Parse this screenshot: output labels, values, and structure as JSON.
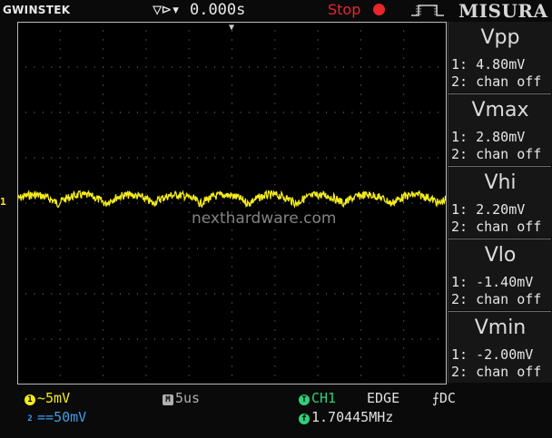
{
  "top": {
    "brand": "GWINSTEK",
    "trigger_position": "0.000s",
    "run_state": "Stop",
    "menu_title": "MISURA"
  },
  "screen": {
    "watermark": "nexthardware.com",
    "ch1_marker": "1"
  },
  "measurements": [
    {
      "name": "Vpp",
      "ch1": "1: 4.80mV",
      "ch2": "2: chan off"
    },
    {
      "name": "Vmax",
      "ch1": "1: 2.80mV",
      "ch2": "2: chan off"
    },
    {
      "name": "Vhi",
      "ch1": "1: 2.20mV",
      "ch2": "2: chan off"
    },
    {
      "name": "Vlo",
      "ch1": "1: -1.40mV",
      "ch2": "2: chan off"
    },
    {
      "name": "Vmin",
      "ch1": "1: -2.00mV",
      "ch2": "2: chan off"
    }
  ],
  "status": {
    "ch1_badge": "1",
    "ch1_coupling": "~",
    "ch1_scale": "5mV",
    "ch2_badge": "2",
    "ch2_coupling": "==",
    "ch2_scale": "50mV",
    "timebase_badge": "M",
    "timebase": "5us",
    "trigger_badge": "T",
    "trigger_source": "CH1",
    "trigger_type": "EDGE",
    "trigger_coupling": "DC",
    "freq_badge": "f",
    "frequency": "1.70445MHz"
  },
  "colors": {
    "ch1": "#f4ec1a",
    "ch2": "#3aa0e8",
    "timebase": "#b0b0b0",
    "trigger": "#2fd07a",
    "stop": "#e8262a"
  }
}
